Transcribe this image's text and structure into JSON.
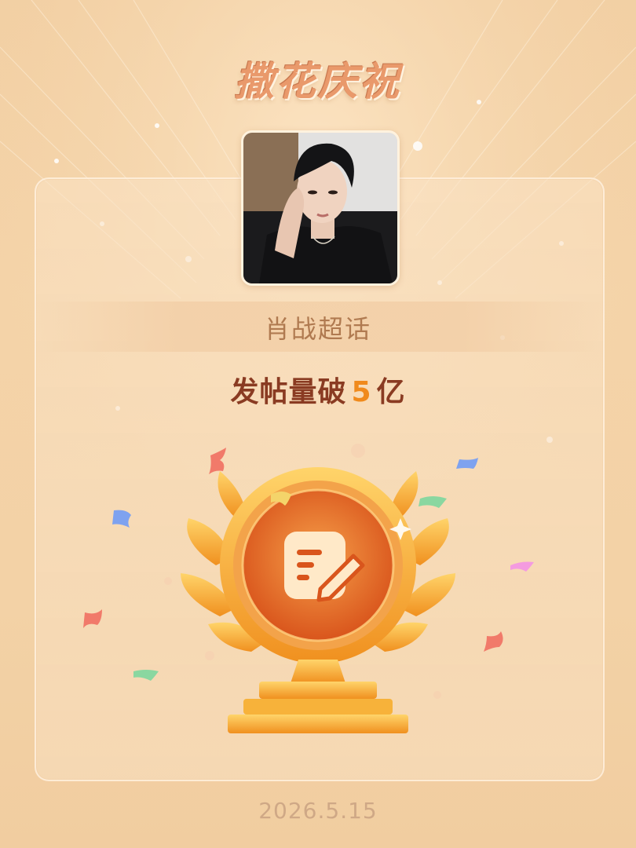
{
  "banner": {
    "title": "撒花庆祝"
  },
  "topic": {
    "name": "肖战超话"
  },
  "achievement": {
    "prefix": "发帖量破",
    "number": "5",
    "suffix": "亿"
  },
  "footer": {
    "date": "2026.5.15"
  },
  "icons": {
    "avatar": "person-portrait-icon",
    "badge": "note-edit-icon",
    "trophy": "laurel-trophy-icon",
    "confetti": "confetti-icon"
  },
  "colors": {
    "background": "#f3d2a6",
    "title": "#e9996b",
    "achievement_text": "#8a3b22",
    "achievement_number": "#f08a1c",
    "topic_text": "#b07a50",
    "date_text": "#cfa886"
  }
}
